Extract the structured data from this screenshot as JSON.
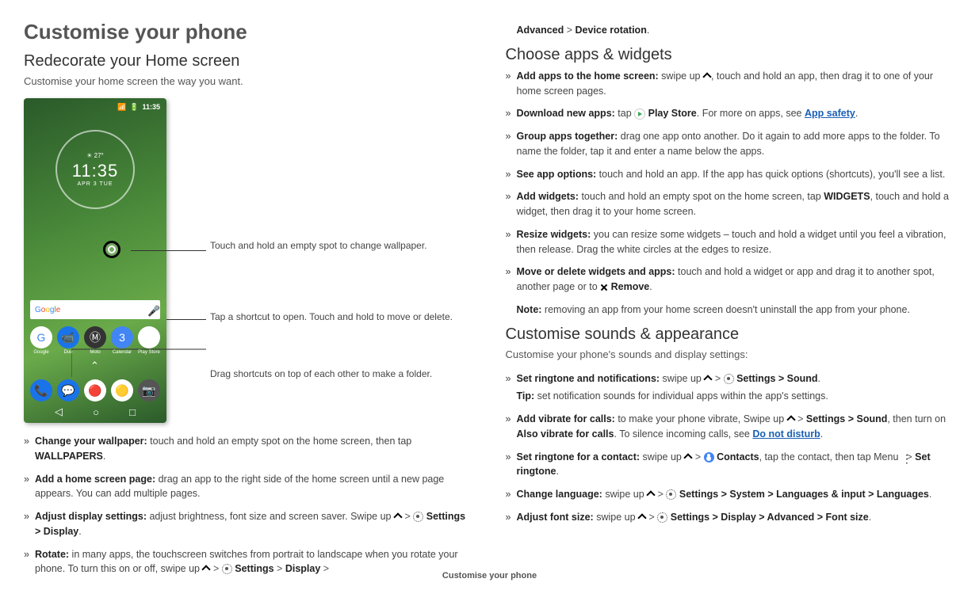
{
  "footer": "Customise your phone",
  "left": {
    "h1": "Customise your phone",
    "h2": "Redecorate your Home screen",
    "intro": "Customise your home screen the way you want.",
    "phone": {
      "status_time": "11:35",
      "signal_label": "signal",
      "battery_label": "battery",
      "clock_temp": "☀ 27°",
      "clock_time": "11:35",
      "clock_date": "APR 3 TUE",
      "search_brand": "Google",
      "apps_row1": [
        "Google",
        "Duo",
        "Moto",
        "Calendar",
        "Play Store"
      ],
      "apps_row2": [
        "Phone",
        "Messages",
        "Chrome",
        "Photos",
        "Camera"
      ]
    },
    "callouts": {
      "c1": "Touch and hold an empty spot to change wallpaper.",
      "c2": "Tap a shortcut to open. Touch and hold to move or delete.",
      "c3": "Drag shortcuts on top of each other to make a folder."
    },
    "bullets": {
      "b1_bold": "Change your wallpaper:",
      "b1_text": " touch and hold an empty spot on the home screen, then tap ",
      "b1_kw": "WALLPAPERS",
      "b2_bold": "Add a home screen page:",
      "b2_text": " drag an app to the right side of the home screen until a new page appears. You can add multiple pages.",
      "b3_bold": "Adjust display settings:",
      "b3_text": " adjust brightness, font size and screen saver. Swipe up ",
      "b3_path": " Settings > Display",
      "b4_bold": "Rotate:",
      "b4_text": " in many apps, the touchscreen switches from portrait to landscape when you rotate your phone. To turn this on or off, swipe up ",
      "b4_path1": " Settings",
      "b4_path2": "Display"
    }
  },
  "right": {
    "cont_bold1": "Advanced",
    "cont_bold2": "Device rotation",
    "h2a": "Choose apps & widgets",
    "apps": {
      "a1_bold": "Add apps to the home screen:",
      "a1_text1": " swipe up ",
      "a1_text2": ", touch and hold an app, then drag it to one of your home screen pages.",
      "a2_bold": "Download new apps:",
      "a2_text1": " tap ",
      "a2_play": " Play Store",
      "a2_text2": ". For more on apps, see ",
      "a2_link": "App safety",
      "a3_bold": "Group apps together:",
      "a3_text": " drag one app onto another. Do it again to add more apps to the folder. To name the folder, tap it and enter a name below the apps.",
      "a4_bold": "See app options:",
      "a4_text": " touch and hold an app. If the app has quick options (shortcuts), you'll see a list.",
      "a5_bold": "Add widgets:",
      "a5_text1": " touch and hold an empty spot on the home screen, tap ",
      "a5_kw": "WIDGETS",
      "a5_text2": ", touch and hold a widget, then drag it to your home screen.",
      "a6_bold": "Resize widgets:",
      "a6_text": " you can resize some widgets – touch and hold a widget until you feel a vibration, then release. Drag the white circles at the edges to resize.",
      "a7_bold": "Move or delete widgets and apps:",
      "a7_text1": " touch and hold a widget or app and drag it to another spot, another page or to ",
      "a7_remove": " Remove",
      "note_bold": "Note:",
      "note_text": " removing an app from your home screen doesn't uninstall the app from your phone."
    },
    "h2b": "Customise sounds & appearance",
    "sounds_intro": "Customise your phone's sounds and display settings:",
    "sounds": {
      "s1_bold": "Set ringtone and notifications:",
      "s1_text": " swipe up ",
      "s1_path": " Settings > Sound",
      "s1_tip_bold": "Tip:",
      "s1_tip": " set notification sounds for individual apps within the app's settings.",
      "s2_bold": "Add vibrate for calls:",
      "s2_text1": " to make your phone vibrate, Swipe up ",
      "s2_path": "Settings > Sound",
      "s2_text2": ", then turn on ",
      "s2_kw": "Also vibrate for calls",
      "s2_text3": ". To silence incoming calls, see ",
      "s2_link": "Do not disturb",
      "s3_bold": "Set ringtone for a contact:",
      "s3_text1": " swipe up ",
      "s3_contacts": " Contacts",
      "s3_text2": ", tap the contact, then tap Menu ",
      "s3_kw": "Set ringtone",
      "s4_bold": "Change language:",
      "s4_text": " swipe up ",
      "s4_path": " Settings > System > Languages & input > Languages",
      "s5_bold": "Adjust font size:",
      "s5_text": " swipe up ",
      "s5_path": " Settings > Display > Advanced > Font size"
    }
  }
}
